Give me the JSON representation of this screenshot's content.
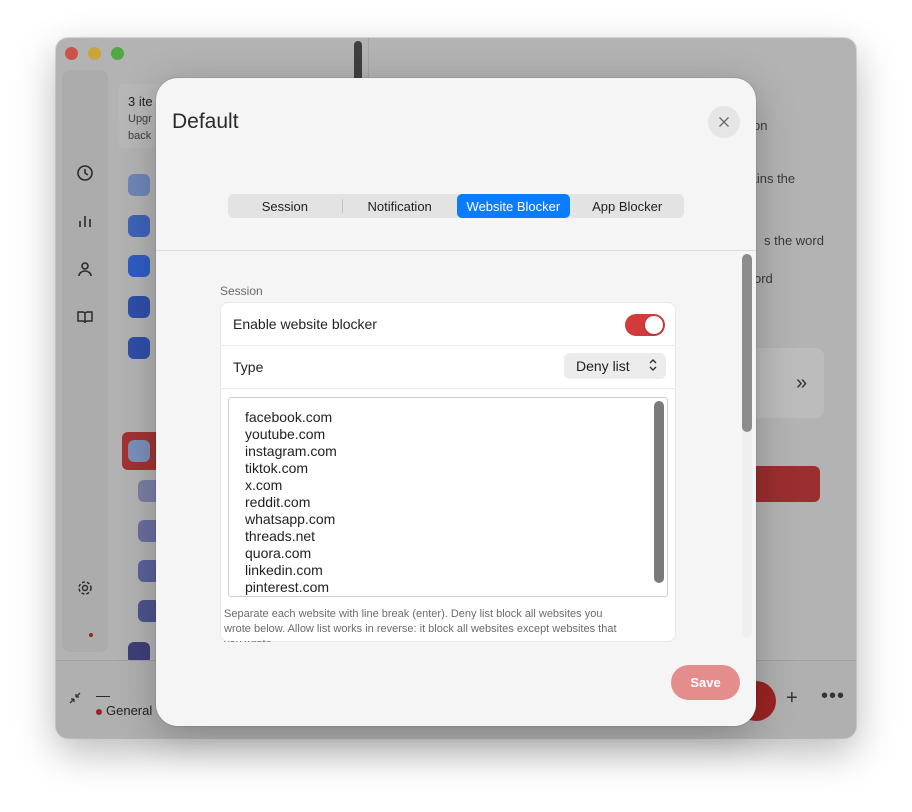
{
  "background_app": {
    "list_card": {
      "title": "3 ite",
      "line1": "Upgr",
      "line2": "back"
    },
    "right_texts": [
      "on",
      "tains the",
      "s the word",
      "ord"
    ],
    "bottom_bar": {
      "dash": "—",
      "session_label": "General",
      "plus": "+",
      "more": "•••"
    },
    "sidebar_icons": [
      "clock-icon",
      "chart-icon",
      "person-icon",
      "book-icon",
      "gear-icon"
    ]
  },
  "modal": {
    "title": "Default",
    "tabs": [
      {
        "label": "Session",
        "active": false
      },
      {
        "label": "Notification",
        "active": false
      },
      {
        "label": "Website Blocker",
        "active": true
      },
      {
        "label": "App Blocker",
        "active": false
      }
    ],
    "section_label": "Session",
    "enable_label": "Enable website blocker",
    "enable_on": true,
    "type_label": "Type",
    "type_value": "Deny list",
    "sites": [
      "facebook.com",
      "youtube.com",
      "instagram.com",
      "tiktok.com",
      "x.com",
      "reddit.com",
      "whatsapp.com",
      "threads.net",
      "quora.com",
      "linkedin.com",
      "pinterest.com"
    ],
    "helper_text": "Separate each website with line break (enter). Deny list block all websites you wrote below. Allow list works in reverse: it block all websites except websites that you wrote.",
    "save_label": "Save"
  },
  "colors": {
    "accent_blue": "#0a7cff",
    "toggle_red": "#d13b3b",
    "save_disabled": "#e58d8d"
  }
}
